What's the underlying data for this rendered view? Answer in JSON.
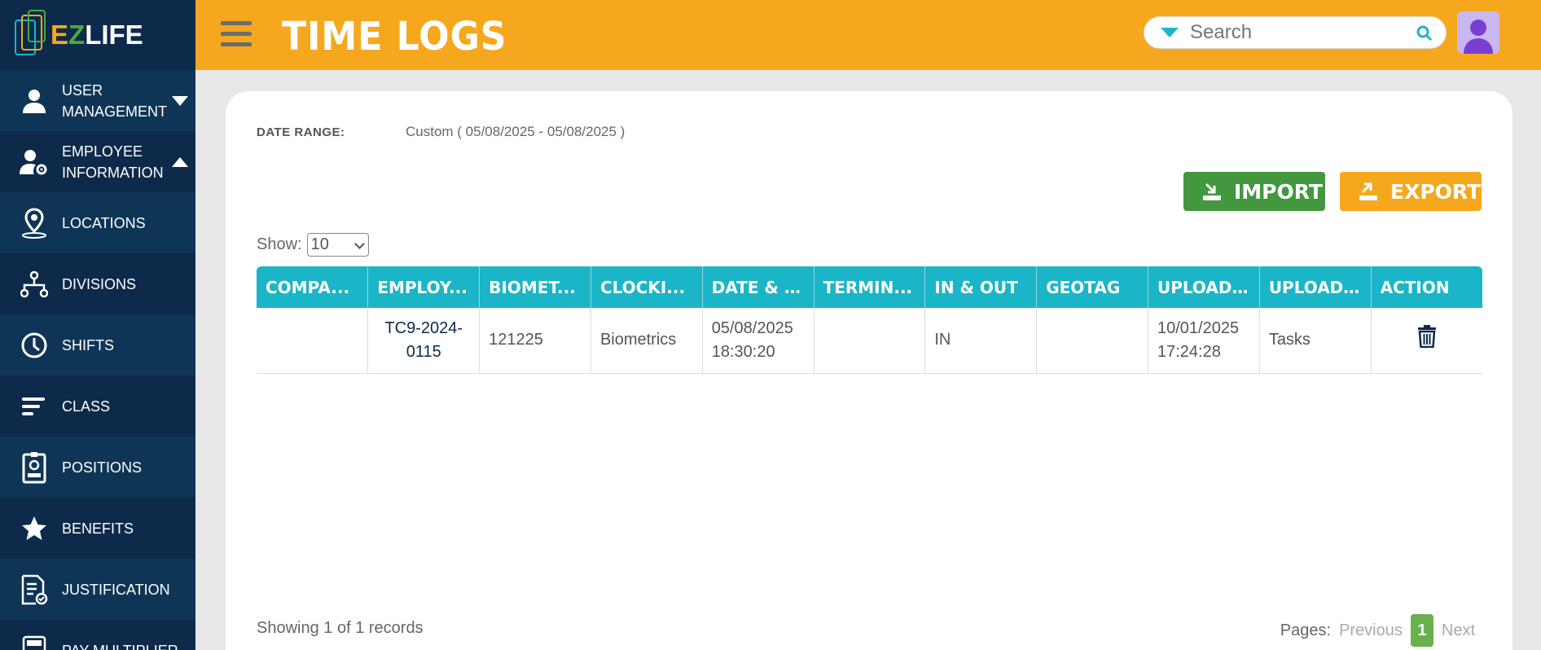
{
  "brand": {
    "logo_e": "E",
    "logo_z": "Z",
    "logo_rest": "LIFE"
  },
  "sidebar": {
    "items": [
      {
        "label": "USER MANAGEMENT",
        "icon": "user-icon"
      },
      {
        "label": "EMPLOYEE INFORMATION",
        "icon": "user-gear-icon"
      },
      {
        "label": "LOCATIONS",
        "icon": "location-pin-icon"
      },
      {
        "label": "DIVISIONS",
        "icon": "org-chart-icon"
      },
      {
        "label": "SHIFTS",
        "icon": "clock-icon"
      },
      {
        "label": "CLASS",
        "icon": "lines-icon"
      },
      {
        "label": "POSITIONS",
        "icon": "id-badge-icon"
      },
      {
        "label": "BENEFITS",
        "icon": "star-icon"
      },
      {
        "label": "JUSTIFICATION",
        "icon": "document-check-icon"
      },
      {
        "label": "PAY MULTIPLIER",
        "icon": "calculator-icon"
      }
    ]
  },
  "header": {
    "title": "TIME LOGS",
    "search_placeholder": "Search"
  },
  "filters": {
    "date_range_label": "DATE RANGE:",
    "date_range_value": "Custom ( 05/08/2025 - 05/08/2025 )"
  },
  "actions": {
    "import_label": "IMPORT",
    "export_label": "EXPORT"
  },
  "show": {
    "label": "Show:",
    "value": "10"
  },
  "table": {
    "columns": [
      "COMPA...",
      "EMPLOY...",
      "BIOMET...",
      "CLOCKI...",
      "DATE & T...",
      "TERMIN...",
      "IN & OUT",
      "GEOTAG",
      "UPLOAD...",
      "UPLOAD...",
      "ACTION"
    ],
    "rows": [
      {
        "company": "",
        "employee_line1": "TC9-2024-",
        "employee_line2": "0115",
        "biometric": "121225",
        "clocking": "Biometrics",
        "datetime_date": "05/08/2025",
        "datetime_time": "18:30:20",
        "terminal": "",
        "in_out": "IN",
        "geotag": "",
        "uploaded_date": "10/01/2025",
        "uploaded_time": "17:24:28",
        "uploaded_by": "Tasks"
      }
    ]
  },
  "footer": {
    "records": "Showing 1 of 1 records",
    "pages_label": "Pages:",
    "previous": "Previous",
    "current_page": "1",
    "next": "Next"
  },
  "colors": {
    "sidebar_bg": "#0d2a4a",
    "header_bg": "#f5a81e",
    "table_header": "#1bb5c8",
    "import_green": "#43973e",
    "export_orange": "#f5a81e"
  }
}
